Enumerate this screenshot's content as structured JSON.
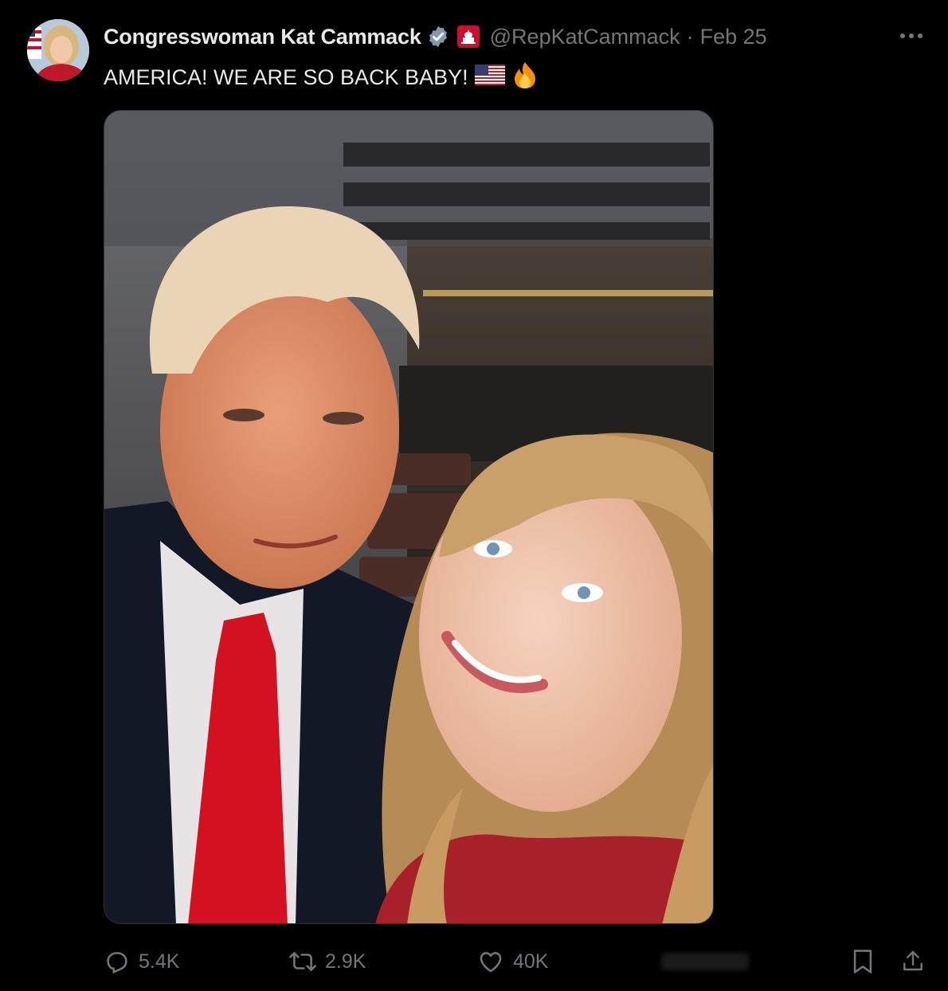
{
  "author": {
    "display_name": "Congresswoman Kat Cammack",
    "handle": "@RepKatCammack",
    "separator": "·",
    "date": "Feb 25",
    "verified_icon": "verified-badge-icon",
    "affiliation_icon": "capitol-affiliation-icon"
  },
  "tweet": {
    "text": "AMERICA! WE ARE SO BACK BABY!",
    "emojis": [
      "us-flag-emoji",
      "fire-emoji"
    ]
  },
  "media": {
    "kind": "selfie-photo"
  },
  "actions": {
    "reply_count": "5.4K",
    "retweet_count": "2.9K",
    "like_count": "40K"
  },
  "colors": {
    "background": "#000000",
    "text": "#e7e9ea",
    "muted": "#71767b",
    "verified_blue": "#1d9bf0",
    "border": "#2f3336"
  }
}
